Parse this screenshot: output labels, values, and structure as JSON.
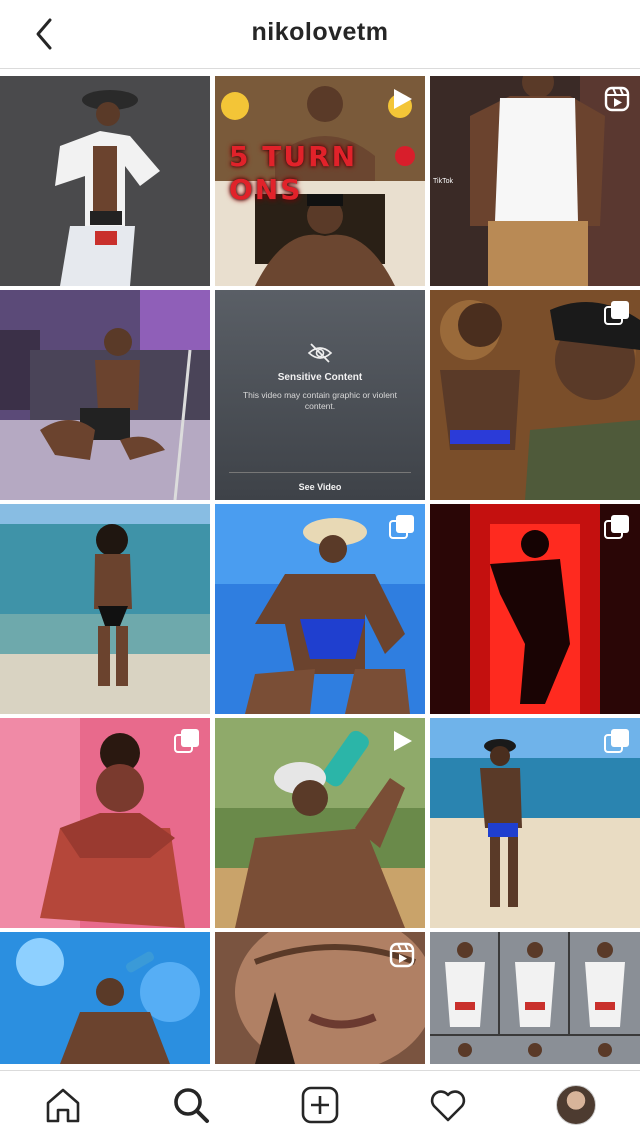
{
  "header": {
    "title": "nikolovetm",
    "back_icon": "chevron-left-icon"
  },
  "posts": [
    {
      "kind": "photo",
      "badge": "none"
    },
    {
      "kind": "video",
      "badge": "play-icon",
      "overlay_text": "5 TURN ONS"
    },
    {
      "kind": "reel",
      "badge": "reels-icon",
      "watermark": "TikTok"
    },
    {
      "kind": "photo",
      "badge": "none"
    },
    {
      "kind": "sensitive",
      "badge": "none"
    },
    {
      "kind": "carousel",
      "badge": "carousel-icon"
    },
    {
      "kind": "photo",
      "badge": "none"
    },
    {
      "kind": "carousel",
      "badge": "carousel-icon"
    },
    {
      "kind": "carousel",
      "badge": "carousel-icon"
    },
    {
      "kind": "carousel",
      "badge": "carousel-icon"
    },
    {
      "kind": "video",
      "badge": "play-icon"
    },
    {
      "kind": "carousel",
      "badge": "carousel-icon"
    },
    {
      "kind": "photo",
      "badge": "none"
    },
    {
      "kind": "reel",
      "badge": "reels-icon"
    },
    {
      "kind": "photo",
      "badge": "none"
    }
  ],
  "sensitive": {
    "title": "Sensitive Content",
    "description": "This video may contain graphic or violent content.",
    "action": "See Video"
  },
  "tabbar": {
    "items": [
      "home-icon",
      "search-icon",
      "new-post-icon",
      "activity-heart-icon",
      "profile-avatar"
    ],
    "active": "search-icon"
  }
}
